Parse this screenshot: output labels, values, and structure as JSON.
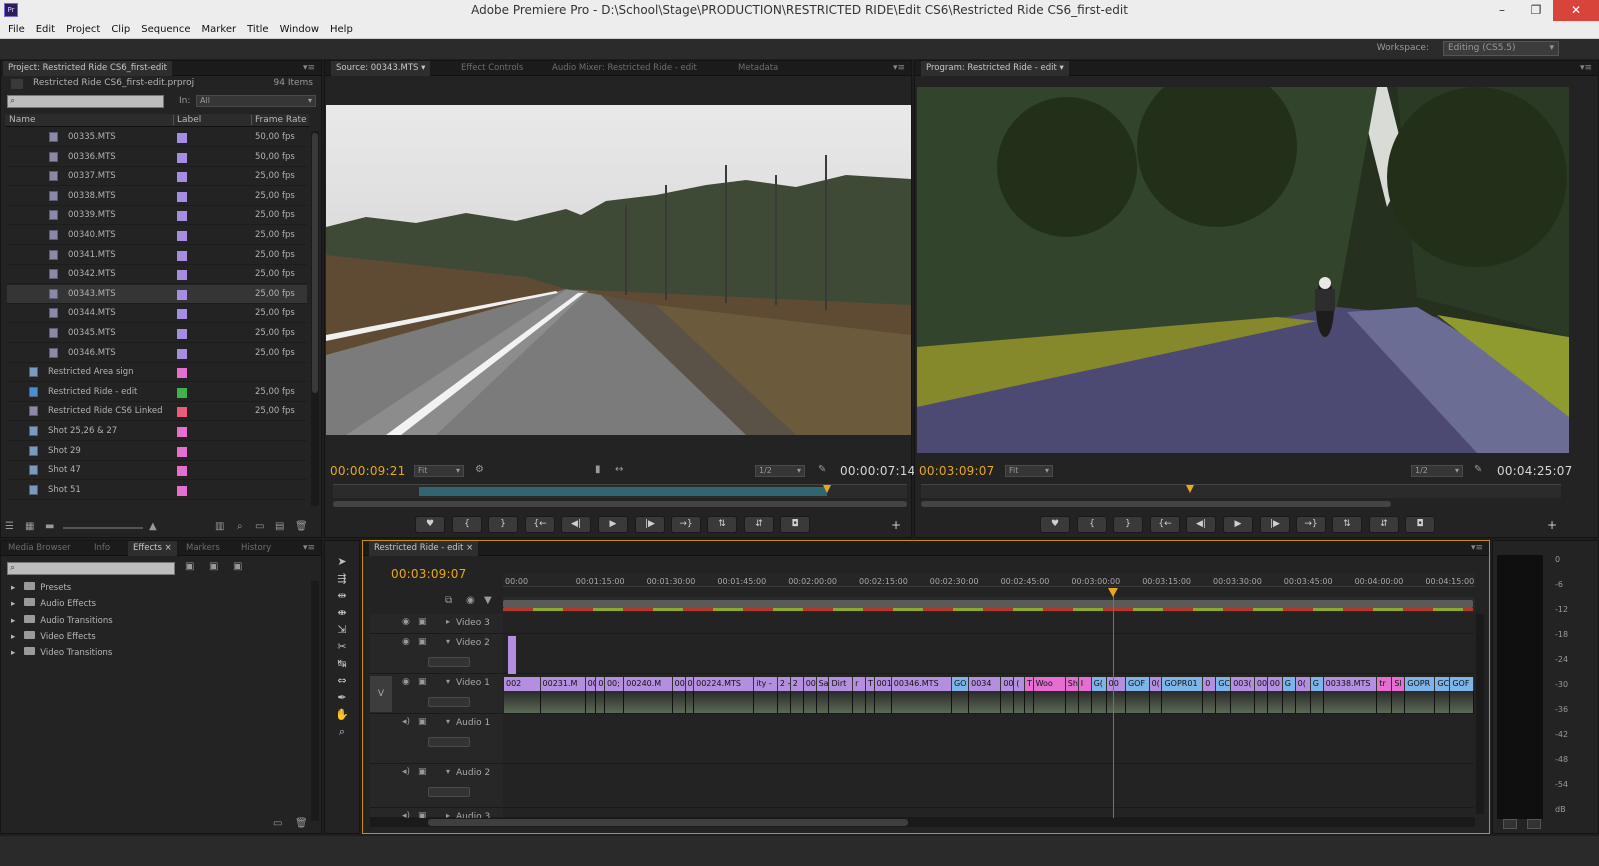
{
  "titlebar": {
    "app_icon": "Pr",
    "title": "Adobe Premiere Pro - D:\\School\\Stage\\PRODUCTION\\RESTRICTED RIDE\\Edit CS6\\Restricted Ride CS6_first-edit",
    "minimize": "–",
    "restore": "❐",
    "close": "✕"
  },
  "menubar": [
    "File",
    "Edit",
    "Project",
    "Clip",
    "Sequence",
    "Marker",
    "Title",
    "Window",
    "Help"
  ],
  "workspace": {
    "label": "Workspace:",
    "value": "Editing (CS5.5)"
  },
  "project": {
    "tab": "Project: Restricted Ride CS6_first-edit",
    "file": "Restricted Ride CS6_first-edit.prproj",
    "count": "94 Items",
    "in_label": "In:",
    "in_value": "All",
    "search_placeholder": "",
    "columns": {
      "name": "Name",
      "label": "Label",
      "frame_rate": "Frame Rate"
    },
    "items": [
      {
        "name": "00335.MTS",
        "color": "#a78de0",
        "fps": "50,00 fps",
        "type": "clip"
      },
      {
        "name": "00336.MTS",
        "color": "#a78de0",
        "fps": "50,00 fps",
        "type": "clip"
      },
      {
        "name": "00337.MTS",
        "color": "#a78de0",
        "fps": "25,00 fps",
        "type": "clip"
      },
      {
        "name": "00338.MTS",
        "color": "#a78de0",
        "fps": "25,00 fps",
        "type": "clip"
      },
      {
        "name": "00339.MTS",
        "color": "#a78de0",
        "fps": "25,00 fps",
        "type": "clip"
      },
      {
        "name": "00340.MTS",
        "color": "#a78de0",
        "fps": "25,00 fps",
        "type": "clip"
      },
      {
        "name": "00341.MTS",
        "color": "#a78de0",
        "fps": "25,00 fps",
        "type": "clip"
      },
      {
        "name": "00342.MTS",
        "color": "#a78de0",
        "fps": "25,00 fps",
        "type": "clip"
      },
      {
        "name": "00343.MTS",
        "color": "#a78de0",
        "fps": "25,00 fps",
        "type": "clip",
        "selected": true
      },
      {
        "name": "00344.MTS",
        "color": "#a78de0",
        "fps": "25,00 fps",
        "type": "clip"
      },
      {
        "name": "00345.MTS",
        "color": "#a78de0",
        "fps": "25,00 fps",
        "type": "clip"
      },
      {
        "name": "00346.MTS",
        "color": "#a78de0",
        "fps": "25,00 fps",
        "type": "clip"
      },
      {
        "name": "Restricted Area sign",
        "color": "#e56fd0",
        "fps": "",
        "type": "still"
      },
      {
        "name": "Restricted Ride - edit",
        "color": "#3db34a",
        "fps": "25,00 fps",
        "type": "sequence"
      },
      {
        "name": "Restricted Ride CS6 Linked",
        "color": "#e95c7a",
        "fps": "25,00 fps",
        "type": "linked"
      },
      {
        "name": "Shot 25,26 & 27",
        "color": "#e56fd0",
        "fps": "",
        "type": "still"
      },
      {
        "name": "Shot 29",
        "color": "#e56fd0",
        "fps": "",
        "type": "still"
      },
      {
        "name": "Shot 47",
        "color": "#e56fd0",
        "fps": "",
        "type": "still"
      },
      {
        "name": "Shot 51",
        "color": "#e56fd0",
        "fps": "",
        "type": "still"
      }
    ]
  },
  "source": {
    "tabs": [
      "Source: 00343.MTS",
      "Effect Controls",
      "Audio Mixer: Restricted Ride - edit",
      "Metadata"
    ],
    "timecode": "00:00:09:21",
    "fit": "Fit",
    "res": "1/2",
    "duration": "00:00:07:14",
    "in_fraction": 0.15,
    "out_fraction": 0.86,
    "playhead_fraction": 0.86
  },
  "program": {
    "tab": "Program: Restricted Ride - edit",
    "timecode": "00:03:09:07",
    "fit": "Fit",
    "res": "1/2",
    "duration": "00:04:25:07",
    "playhead_fraction": 0.42
  },
  "transport_icons": [
    "♥",
    "{",
    "}",
    "{←",
    "◀|",
    "▶",
    "|▶",
    "→}",
    "⇅",
    "⇵",
    "◘"
  ],
  "effects": {
    "tabs": [
      "Media Browser",
      "Info",
      "Effects",
      "Markers",
      "History"
    ],
    "active_tab": "Effects",
    "items": [
      "Presets",
      "Audio Effects",
      "Audio Transitions",
      "Video Effects",
      "Video Transitions"
    ]
  },
  "timeline": {
    "tab": "Restricted Ride - edit",
    "timecode": "00:03:09:07",
    "ruler": [
      "00:00",
      "00:01:15:00",
      "00:01:30:00",
      "00:01:45:00",
      "00:02:00:00",
      "00:02:15:00",
      "00:02:30:00",
      "00:02:45:00",
      "00:03:00:00",
      "00:03:15:00",
      "00:03:30:00",
      "00:03:45:00",
      "00:04:00:00",
      "00:04:15:00",
      "00"
    ],
    "playhead_fraction": 0.628,
    "tracks": [
      "Video 3",
      "Video 2",
      "Video 1",
      "Audio 1",
      "Audio 2",
      "Audio 3"
    ],
    "v_label": "V",
    "clips_v1": [
      {
        "t": "002",
        "c": "#b48fe0"
      },
      {
        "t": "00231.M",
        "c": "#b48fe0"
      },
      {
        "t": "00",
        "c": "#b48fe0"
      },
      {
        "t": "0",
        "c": "#b48fe0"
      },
      {
        "t": "00;",
        "c": "#b48fe0"
      },
      {
        "t": "00240.M",
        "c": "#b48fe0"
      },
      {
        "t": "00",
        "c": "#b48fe0"
      },
      {
        "t": "0",
        "c": "#b48fe0"
      },
      {
        "t": "00224.MTS",
        "c": "#b48fe0"
      },
      {
        "t": "ity -",
        "c": "#b48fe0"
      },
      {
        "t": "2 -",
        "c": "#b48fe0"
      },
      {
        "t": "2",
        "c": "#b48fe0"
      },
      {
        "t": "00",
        "c": "#b48fe0"
      },
      {
        "t": "Sa",
        "c": "#b48fe0"
      },
      {
        "t": "Dirt",
        "c": "#b48fe0"
      },
      {
        "t": "r",
        "c": "#b48fe0"
      },
      {
        "t": "T",
        "c": "#b48fe0"
      },
      {
        "t": "001",
        "c": "#b48fe0"
      },
      {
        "t": "00346.MTS",
        "c": "#b48fe0"
      },
      {
        "t": "GO",
        "c": "#7fb4e8"
      },
      {
        "t": "0034",
        "c": "#b48fe0"
      },
      {
        "t": "00",
        "c": "#b48fe0"
      },
      {
        "t": "(",
        "c": "#b48fe0"
      },
      {
        "t": "T",
        "c": "#e56fd0"
      },
      {
        "t": "Woo",
        "c": "#e56fd0"
      },
      {
        "t": "Sh",
        "c": "#e56fd0"
      },
      {
        "t": "I",
        "c": "#e56fd0"
      },
      {
        "t": "G(",
        "c": "#7fb4e8"
      },
      {
        "t": "00",
        "c": "#b48fe0"
      },
      {
        "t": "GOF",
        "c": "#7fb4e8"
      },
      {
        "t": "0(",
        "c": "#b48fe0"
      },
      {
        "t": "GOPR01",
        "c": "#7fb4e8"
      },
      {
        "t": "0",
        "c": "#b48fe0"
      },
      {
        "t": "GC",
        "c": "#7fb4e8"
      },
      {
        "t": "003(",
        "c": "#b48fe0"
      },
      {
        "t": "00",
        "c": "#b48fe0"
      },
      {
        "t": "00",
        "c": "#b48fe0"
      },
      {
        "t": "G",
        "c": "#7fb4e8"
      },
      {
        "t": "0(",
        "c": "#b48fe0"
      },
      {
        "t": "G",
        "c": "#7fb4e8"
      },
      {
        "t": "00338.MTS",
        "c": "#b48fe0"
      },
      {
        "t": "tr",
        "c": "#e56fd0"
      },
      {
        "t": "Sl",
        "c": "#e56fd0"
      },
      {
        "t": "GOPR",
        "c": "#7fb4e8"
      },
      {
        "t": "GC",
        "c": "#7fb4e8"
      },
      {
        "t": "GOF",
        "c": "#7fb4e8"
      }
    ],
    "meter_scale": [
      "0",
      "-6",
      "-12",
      "-18",
      "-24",
      "-30",
      "-36",
      "-42",
      "-48",
      "-54",
      "dB"
    ]
  }
}
